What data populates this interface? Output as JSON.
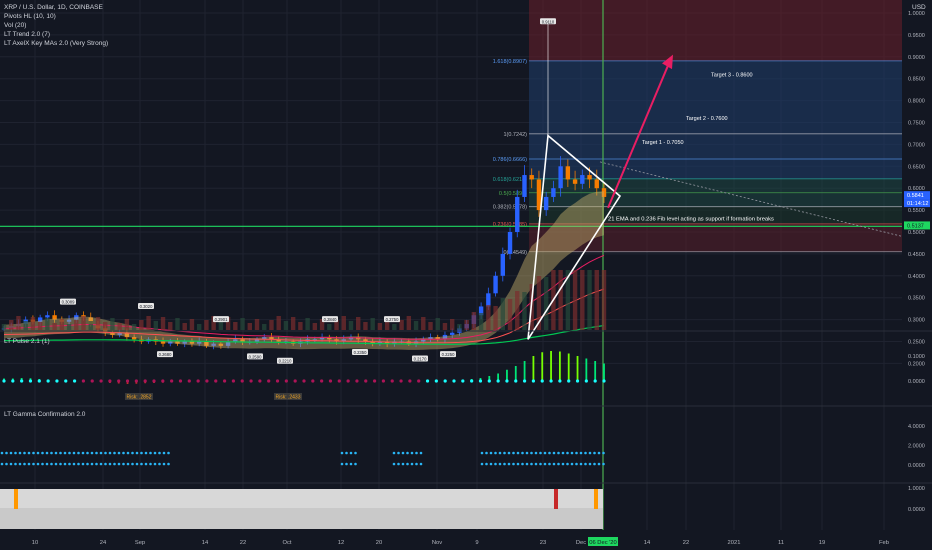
{
  "legend": {
    "symbol": "XRP / U.S. Dollar, 1D, COINBASE",
    "indicators": [
      "Pivots HL (10, 10)",
      "Vol (20)",
      "LT Trend 2.0 (7)",
      "LT AxelX Key MAs 2.0 (Very Strong)"
    ]
  },
  "panels": {
    "pulse": "LT Pulse 2.1 (1)",
    "gamma": "LT Gamma Confirmation 2.0"
  },
  "currency": "USD",
  "colors": {
    "up": "#2962ff",
    "down": "#f57c00",
    "ema_band": "#c8b16c",
    "fib_green": "#1ed760",
    "vline": "#4caf50",
    "target_arrow": "#e91e63",
    "triangle": "#ffffff"
  },
  "chart_data": [
    {
      "type": "line",
      "title": "XRP / U.S. Dollar, 1D, COINBASE",
      "y_axis": {
        "unit": "USD",
        "ticks": [
          "1.0000",
          "0.9500",
          "0.9000",
          "0.8500",
          "0.8000",
          "0.7500",
          "0.7000",
          "0.6500",
          "0.6000",
          "0.5500",
          "0.5000",
          "0.4500",
          "0.4000",
          "0.3500",
          "0.3000",
          "0.2500",
          "0.2000"
        ],
        "ylim": [
          0.17,
          1.02
        ]
      },
      "x_axis": {
        "ticks": [
          "10",
          "24",
          "Sep",
          "14",
          "22",
          "Oct",
          "12",
          "20",
          "Nov",
          "9",
          "23",
          "Dec",
          "14",
          "22",
          "2021",
          "11",
          "19",
          "Feb"
        ]
      },
      "price_series_close": [
        0.28,
        0.285,
        0.29,
        0.3,
        0.295,
        0.305,
        0.31,
        0.3,
        0.295,
        0.3,
        0.31,
        0.305,
        0.29,
        0.28,
        0.27,
        0.265,
        0.27,
        0.26,
        0.255,
        0.25,
        0.255,
        0.25,
        0.245,
        0.25,
        0.245,
        0.25,
        0.245,
        0.25,
        0.24,
        0.245,
        0.24,
        0.25,
        0.255,
        0.25,
        0.25,
        0.255,
        0.26,
        0.255,
        0.25,
        0.25,
        0.245,
        0.25,
        0.255,
        0.255,
        0.26,
        0.255,
        0.25,
        0.255,
        0.26,
        0.255,
        0.25,
        0.245,
        0.25,
        0.245,
        0.25,
        0.25,
        0.245,
        0.25,
        0.255,
        0.26,
        0.255,
        0.265,
        0.27,
        0.28,
        0.29,
        0.31,
        0.33,
        0.36,
        0.4,
        0.45,
        0.5,
        0.58,
        0.63,
        0.62,
        0.55,
        0.58,
        0.6,
        0.65,
        0.62,
        0.61,
        0.63,
        0.62,
        0.6,
        0.58
      ],
      "fib_levels": [
        {
          "label": "1.618(0.8907)",
          "value": 0.8907,
          "color": "#5b9cf6"
        },
        {
          "label": "1(0.7242)",
          "value": 0.7242,
          "color": "#b2b5be"
        },
        {
          "label": "0.786(0.6666)",
          "value": 0.6666,
          "color": "#5b9cf6"
        },
        {
          "label": "0.618(0.6214)",
          "value": 0.6214,
          "color": "#26a69a"
        },
        {
          "label": "0.5(0.5896)",
          "value": 0.5896,
          "color": "#4caf50"
        },
        {
          "label": "0.382(0.5578)",
          "value": 0.5578,
          "color": "#b2b5be"
        },
        {
          "label": "0.236(0.5185)",
          "value": 0.5185,
          "color": "#ef5350"
        },
        {
          "label": "0(0.4549)",
          "value": 0.4549,
          "color": "#b2b5be"
        }
      ],
      "targets": [
        {
          "label": "Target 3 - 0.8600",
          "value": 0.86
        },
        {
          "label": "Target 2 - 0.7600",
          "value": 0.76
        },
        {
          "label": "Target 1 - 0.7050",
          "value": 0.705
        }
      ],
      "annotation": "21 EMA and 0.236 Fib level acting as support if formation breaks",
      "price_tags": [
        {
          "label": "0.5841",
          "value": 0.5841,
          "color": "#2962ff"
        },
        {
          "label": "01:14:12",
          "value": 0.566,
          "color": "#2962ff"
        },
        {
          "label": "0.5137",
          "value": 0.515,
          "color": "#1ed760"
        }
      ],
      "date_tag": "06 Dec '20",
      "pivot_tags": [
        "0.9110",
        "0.3089",
        "0.3020",
        "0.2901",
        "0.2840",
        "0.2750",
        "0.2680",
        "0.2590",
        "0.2350",
        "0.2250",
        "0.2210",
        "0.2170"
      ]
    },
    {
      "type": "bar",
      "title": "LT Pulse 2.1 (1)",
      "y_axis": {
        "ticks": [
          "0.1000",
          "0.0000"
        ],
        "ylim": [
          -0.03,
          0.14
        ]
      },
      "values": [
        0.01,
        0.01,
        0.012,
        0.011,
        0.008,
        0.006,
        0.004,
        0.003,
        0.002,
        -0.002,
        -0.004,
        -0.006,
        -0.008,
        -0.01,
        -0.012,
        -0.011,
        -0.009,
        -0.008,
        -0.007,
        -0.006,
        -0.005,
        -0.004,
        -0.003,
        -0.002,
        -0.004,
        -0.005,
        -0.006,
        -0.004,
        -0.003,
        -0.002,
        -0.002,
        -0.003,
        -0.004,
        -0.005,
        -0.004,
        -0.003,
        -0.002,
        -0.001,
        -0.001,
        -0.002,
        -0.003,
        -0.002,
        -0.001,
        -0.001,
        -0.002,
        -0.002,
        -0.001,
        -0.001,
        0.0,
        0.001,
        0.002,
        0.003,
        0.005,
        0.008,
        0.012,
        0.02,
        0.03,
        0.045,
        0.06,
        0.08,
        0.1,
        0.115,
        0.12,
        0.118,
        0.11,
        0.1,
        0.09,
        0.08,
        0.07
      ],
      "labels": [
        "Risk: .2852",
        "Risk: .2433"
      ]
    },
    {
      "type": "scatter",
      "title": "LT Gamma Confirmation 2.0",
      "y_axis": {
        "ticks": [
          "4.0000",
          "2.0000",
          "0.0000"
        ],
        "ylim": [
          -1,
          5
        ]
      }
    },
    {
      "type": "heatmap",
      "y_axis": {
        "ticks": [
          "1.0000",
          "0.0000"
        ]
      }
    }
  ]
}
